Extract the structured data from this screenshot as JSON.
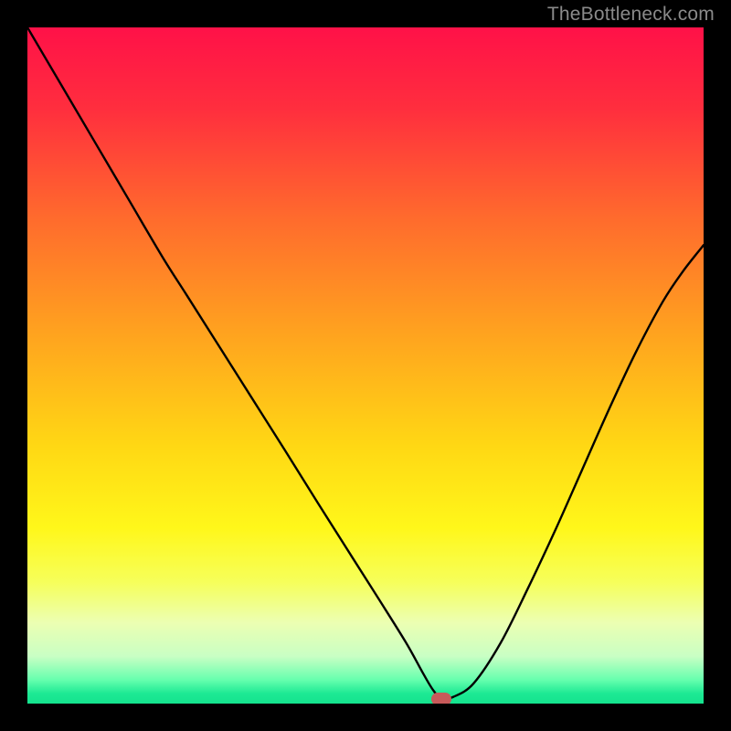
{
  "watermark": "TheBottleneck.com",
  "marker": {
    "x_frac": 0.612,
    "y_frac": 0.993,
    "color": "#c85a5a"
  },
  "gradient_stops": [
    {
      "offset": 0.0,
      "color": "#ff1148"
    },
    {
      "offset": 0.12,
      "color": "#ff2e3e"
    },
    {
      "offset": 0.28,
      "color": "#ff6a2d"
    },
    {
      "offset": 0.45,
      "color": "#ffa21f"
    },
    {
      "offset": 0.62,
      "color": "#ffd814"
    },
    {
      "offset": 0.74,
      "color": "#fff71a"
    },
    {
      "offset": 0.82,
      "color": "#f6ff5a"
    },
    {
      "offset": 0.88,
      "color": "#ecffb2"
    },
    {
      "offset": 0.93,
      "color": "#c9ffc4"
    },
    {
      "offset": 0.965,
      "color": "#66ffae"
    },
    {
      "offset": 0.985,
      "color": "#1de994"
    },
    {
      "offset": 1.0,
      "color": "#14e38e"
    }
  ],
  "chart_data": {
    "type": "line",
    "title": "",
    "xlabel": "",
    "ylabel": "",
    "xlim": [
      0,
      1
    ],
    "ylim": [
      0,
      1
    ],
    "series": [
      {
        "name": "bottleneck-curve",
        "x": [
          0.0,
          0.05,
          0.1,
          0.15,
          0.2,
          0.235,
          0.28,
          0.33,
          0.38,
          0.43,
          0.48,
          0.52,
          0.56,
          0.585,
          0.6,
          0.612,
          0.63,
          0.66,
          0.7,
          0.74,
          0.78,
          0.82,
          0.86,
          0.9,
          0.94,
          0.97,
          1.0
        ],
        "y": [
          1.0,
          0.915,
          0.83,
          0.745,
          0.66,
          0.605,
          0.534,
          0.455,
          0.376,
          0.296,
          0.217,
          0.154,
          0.09,
          0.045,
          0.02,
          0.008,
          0.01,
          0.03,
          0.09,
          0.17,
          0.255,
          0.345,
          0.435,
          0.52,
          0.595,
          0.64,
          0.678
        ]
      }
    ],
    "grid": false,
    "legend": false
  }
}
